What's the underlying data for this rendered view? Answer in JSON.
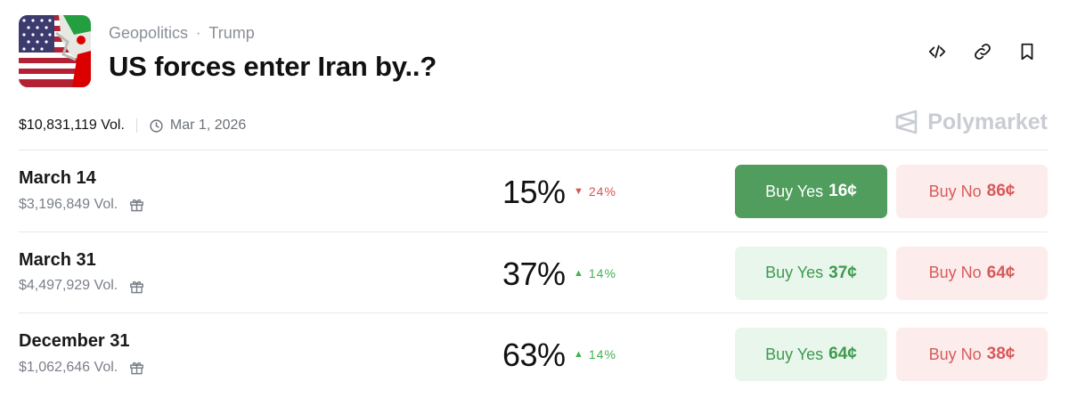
{
  "header": {
    "category": "Geopolitics",
    "separator": "·",
    "tag": "Trump",
    "title": "US forces enter Iran by..?"
  },
  "meta": {
    "volume": "$10,831,119 Vol.",
    "end_date": "Mar 1, 2026"
  },
  "brand": {
    "name": "Polymarket"
  },
  "colors": {
    "yes_active_bg": "#509d5d",
    "yes_bg": "#e9f6ec",
    "yes_text": "#3d9a4f",
    "no_bg": "#fdecec",
    "no_text": "#d65a5a",
    "up": "#3fb34f",
    "down": "#d9534f"
  },
  "rows": [
    {
      "name": "March 14",
      "volume": "$3,196,849 Vol.",
      "percent": "15%",
      "change": "24%",
      "direction": "down",
      "yes_label": "Buy Yes",
      "yes_price": "16¢",
      "no_label": "Buy No",
      "no_price": "86¢"
    },
    {
      "name": "March 31",
      "volume": "$4,497,929 Vol.",
      "percent": "37%",
      "change": "14%",
      "direction": "up",
      "yes_label": "Buy Yes",
      "yes_price": "37¢",
      "no_label": "Buy No",
      "no_price": "64¢"
    },
    {
      "name": "December 31",
      "volume": "$1,062,646 Vol.",
      "percent": "63%",
      "change": "14%",
      "direction": "up",
      "yes_label": "Buy Yes",
      "yes_price": "64¢",
      "no_label": "Buy No",
      "no_price": "38¢"
    }
  ],
  "icons": [
    "embed-code-icon",
    "link-icon",
    "bookmark-icon",
    "clock-icon",
    "polymarket-logo-icon",
    "gift-icon"
  ]
}
